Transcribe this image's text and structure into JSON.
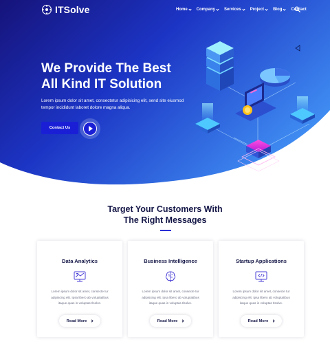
{
  "brand": {
    "name": "ITSolve"
  },
  "nav": {
    "items": [
      {
        "label": "Home",
        "dropdown": true
      },
      {
        "label": "Company",
        "dropdown": true
      },
      {
        "label": "Services",
        "dropdown": true
      },
      {
        "label": "Project",
        "dropdown": true
      },
      {
        "label": "Blog",
        "dropdown": true
      },
      {
        "label": "Contact",
        "dropdown": false
      }
    ],
    "search_icon": "search-icon"
  },
  "hero": {
    "title_line1": "We Provide The Best",
    "title_line2": "All Kind IT Solution",
    "text_line1": "Lorem ipsum dolor sit amet, consectetur adipisicing elit, send site eiusmod",
    "text_line2": "tempor incididunt laboret dolore magna aliqua.",
    "cta_label": "Contact Us",
    "colors": {
      "gradient_start": "#1a1a8a",
      "gradient_end": "#3aa3ff",
      "button": "#1a1fd6"
    }
  },
  "section": {
    "title_line1": "Target Your Customers With",
    "title_line2": "The Right Messages"
  },
  "cards": [
    {
      "title": "Data Analytics",
      "icon": "analytics-icon",
      "text1": "Lorem ipsum dolor sit amet, consecte tur",
      "text2": "adipiscing elit. Ipsa libero ab voluptatibus",
      "text3": "itaque quas in voluptas Ilsolve.",
      "button": "Read More"
    },
    {
      "title": "Business Intelligence",
      "icon": "brain-icon",
      "text1": "Lorem ipsum dolor sit amet, consecte tur",
      "text2": "adipiscing elit. Ipsa libero ab voluptatibus",
      "text3": "itaque quas in voluptas Ilsolve.",
      "button": "Read More"
    },
    {
      "title": "Startup Applications",
      "icon": "monitor-code-icon",
      "text1": "Lorem ipsum dolor sit amet, consecte tur",
      "text2": "adipiscing elit. Ipsa libero ab voluptatibus",
      "text3": "itaque quas in voluptas Ilsolve.",
      "button": "Read More"
    }
  ]
}
